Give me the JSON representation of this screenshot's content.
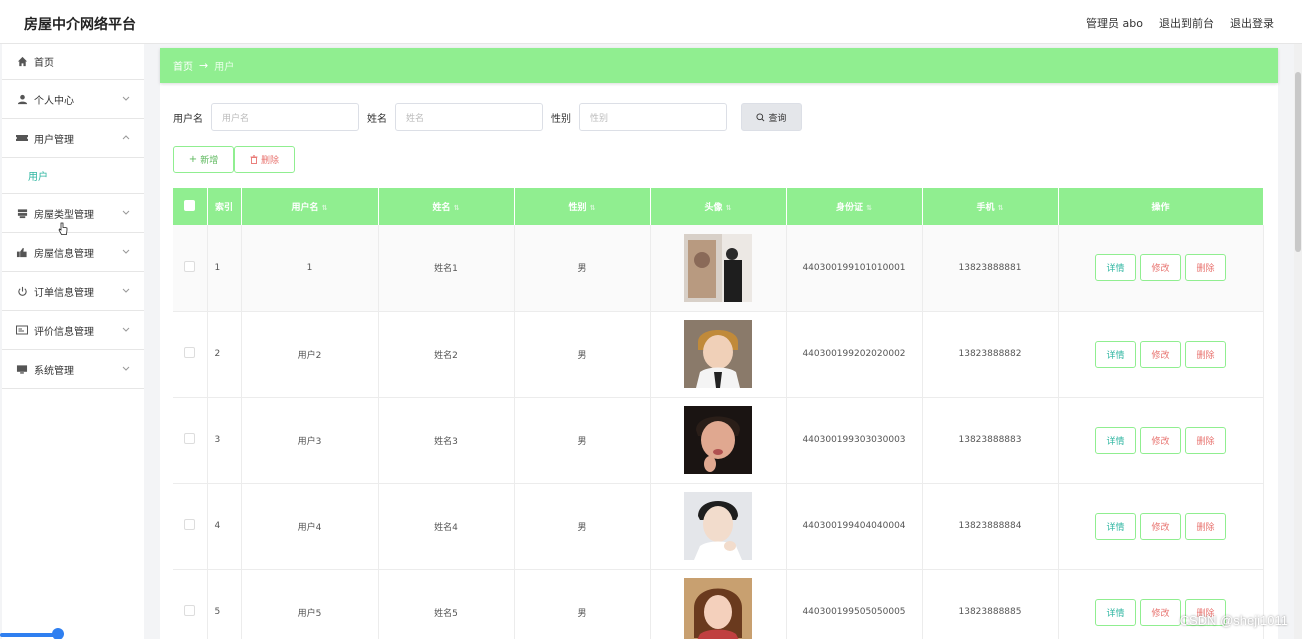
{
  "header": {
    "brand": "房屋中介网络平台",
    "user": "管理员 abo",
    "to_front": "退出到前台",
    "logout": "退出登录"
  },
  "sidebar": {
    "items": [
      {
        "label": "首页",
        "icon": "home-icon"
      },
      {
        "label": "个人中心",
        "icon": "user-icon"
      },
      {
        "label": "用户管理",
        "icon": "ticket-icon"
      },
      {
        "label": "用户",
        "icon": ""
      },
      {
        "label": "房屋类型管理",
        "icon": "stack-icon"
      },
      {
        "label": "房屋信息管理",
        "icon": "thumb-icon"
      },
      {
        "label": "订单信息管理",
        "icon": "power-icon"
      },
      {
        "label": "评价信息管理",
        "icon": "card-icon"
      },
      {
        "label": "系统管理",
        "icon": "monitor-icon"
      }
    ]
  },
  "breadcrumb": {
    "home": "首页",
    "arrow": "→",
    "current": "用户"
  },
  "search": {
    "username_label": "用户名",
    "username_placeholder": "用户名",
    "name_label": "姓名",
    "name_placeholder": "姓名",
    "gender_label": "性别",
    "gender_placeholder": "性别",
    "query_button": "查询"
  },
  "actions": {
    "add": "新增",
    "delete": "删除"
  },
  "table": {
    "headers": [
      "索引",
      "用户名",
      "姓名",
      "性别",
      "头像",
      "身份证",
      "手机",
      "操作"
    ],
    "rows": [
      {
        "index": "1",
        "username": "1",
        "name": "姓名1",
        "gender": "男",
        "id_card": "440300199101010001",
        "phone": "13823888881"
      },
      {
        "index": "2",
        "username": "用户2",
        "name": "姓名2",
        "gender": "男",
        "id_card": "440300199202020002",
        "phone": "13823888882"
      },
      {
        "index": "3",
        "username": "用户3",
        "name": "姓名3",
        "gender": "男",
        "id_card": "440300199303030003",
        "phone": "13823888883"
      },
      {
        "index": "4",
        "username": "用户4",
        "name": "姓名4",
        "gender": "男",
        "id_card": "440300199404040004",
        "phone": "13823888884"
      },
      {
        "index": "5",
        "username": "用户5",
        "name": "姓名5",
        "gender": "男",
        "id_card": "440300199505050005",
        "phone": "13823888885"
      }
    ],
    "op_detail": "详情",
    "op_edit": "修改",
    "op_delete": "删除"
  },
  "watermark": "CSDN @sheji1011",
  "colors": {
    "accent": "#90ee90",
    "link": "#2fb6a1",
    "danger": "#e8736f"
  }
}
